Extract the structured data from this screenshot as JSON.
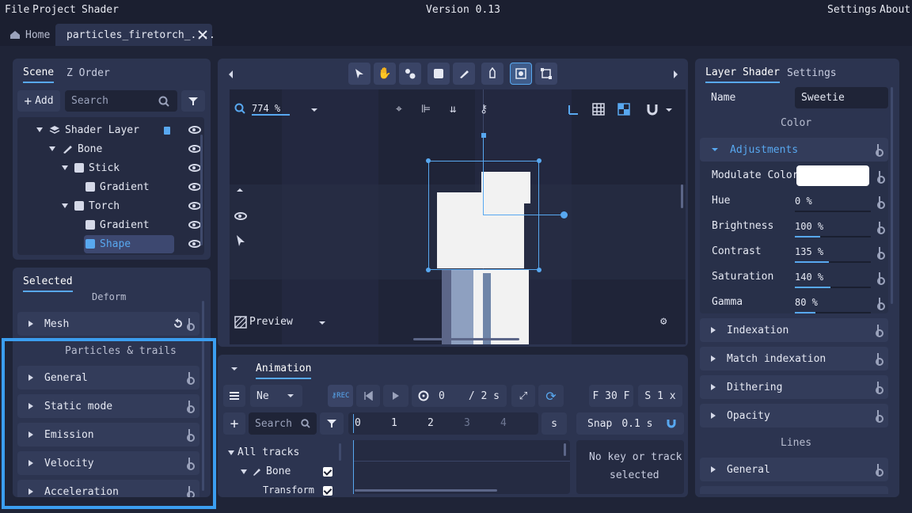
{
  "menu": {
    "file": "File",
    "project": "Project",
    "shader": "Shader",
    "version": "Version 0.13",
    "settings": "Settings",
    "about": "About"
  },
  "tabs": {
    "home": "Home",
    "file": "particles_firetorch_...."
  },
  "scene_panel": {
    "tab_scene": "Scene",
    "tab_zorder": "Z Order",
    "add_label": "Add",
    "search_placeholder": "Search",
    "tree": [
      {
        "label": "Shader Layer"
      },
      {
        "label": "Bone"
      },
      {
        "label": "Stick"
      },
      {
        "label": "Gradient"
      },
      {
        "label": "Torch"
      },
      {
        "label": "Gradient"
      },
      {
        "label": "Shape"
      }
    ]
  },
  "selected_panel": {
    "tab": "Selected",
    "deform": "Deform",
    "mesh": "Mesh",
    "particles_header": "Particles & trails",
    "sections": [
      "General",
      "Static mode",
      "Emission",
      "Velocity",
      "Acceleration"
    ]
  },
  "viewport": {
    "zoom": "774 %",
    "preview": "Preview"
  },
  "animation": {
    "tab": "Animation",
    "track_select": "Ne",
    "time_value": "0",
    "time_total": "/ 2 s",
    "fps": "F 30 F",
    "speed": "S 1 x",
    "search_placeholder": "Search",
    "ticks": [
      "0",
      "1",
      "2",
      "3",
      "4"
    ],
    "unit": "s",
    "snap_label": "Snap",
    "snap_value": "0.1 s",
    "all_tracks": "All tracks",
    "bone": "Bone",
    "transform": "Transform",
    "empty_msg_1": "No key or track",
    "empty_msg_2": "selected"
  },
  "right_panel": {
    "tab_layer_shader": "Layer Shader",
    "tab_settings": "Settings",
    "name_label": "Name",
    "name_value": "Sweetie",
    "color_header": "Color",
    "adjustments": "Adjustments",
    "modulate_color": "Modulate Color",
    "props": [
      {
        "label": "Hue",
        "value": "0 %",
        "fill": 0.0
      },
      {
        "label": "Brightness",
        "value": "100 %",
        "fill": 0.33
      },
      {
        "label": "Contrast",
        "value": "135 %",
        "fill": 0.45
      },
      {
        "label": "Saturation",
        "value": "140 %",
        "fill": 0.47
      },
      {
        "label": "Gamma",
        "value": "80 %",
        "fill": 0.27
      }
    ],
    "sections": [
      "Indexation",
      "Match indexation",
      "Dithering",
      "Opacity"
    ],
    "lines_header": "Lines",
    "lines_general": "General"
  },
  "colors": {
    "accent": "#58a8f0",
    "panel": "#2c3450",
    "background": "#1b1f30"
  }
}
